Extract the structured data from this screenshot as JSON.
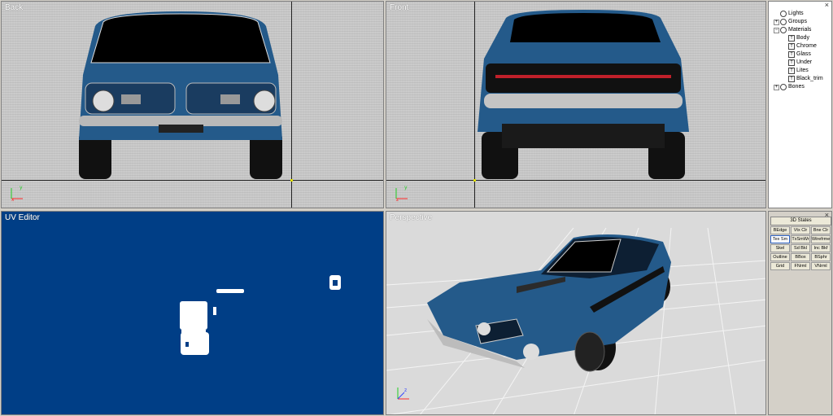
{
  "viewports": {
    "back": {
      "title": "Back"
    },
    "front": {
      "title": "Front"
    },
    "uv": {
      "title": "UV Editor"
    },
    "perspective": {
      "title": "Perspective"
    }
  },
  "scene_tree": {
    "close": "×",
    "items": [
      {
        "label": "Lights",
        "icon": "light-icon"
      },
      {
        "label": "Groups",
        "icon": "group-icon",
        "expander": "+"
      },
      {
        "label": "Materials",
        "icon": "materials-icon",
        "expander": "−"
      },
      {
        "label": "Body",
        "icon": "material-icon"
      },
      {
        "label": "Chrome",
        "icon": "material-icon"
      },
      {
        "label": "Glass",
        "icon": "material-icon"
      },
      {
        "label": "Under",
        "icon": "material-icon"
      },
      {
        "label": "Lites",
        "icon": "material-icon"
      },
      {
        "label": "Black_trim",
        "icon": "material-icon"
      },
      {
        "label": "Bones",
        "icon": "bones-icon",
        "expander": "+"
      }
    ]
  },
  "states_panel": {
    "close": "×",
    "title": "3D States",
    "buttons": [
      {
        "label": "BEdge"
      },
      {
        "label": "Vtx Clr"
      },
      {
        "label": "Bne Clr"
      },
      {
        "label": "Tex Sm",
        "active": true
      },
      {
        "label": "TxSmWr"
      },
      {
        "label": "Wirefrme"
      },
      {
        "label": "Skel"
      },
      {
        "label": "Sd Bkl"
      },
      {
        "label": "Inc Bkf"
      },
      {
        "label": "Outline"
      },
      {
        "label": "BBox"
      },
      {
        "label": "BSphr"
      },
      {
        "label": "Grid"
      },
      {
        "label": "FNrml"
      },
      {
        "label": "VNrml"
      }
    ]
  },
  "colors": {
    "car_body": "#245a8a",
    "uv_background": "#003e86",
    "axis_x": "#ff2a2a",
    "axis_y": "#22cc22",
    "axis_z": "#3344ff"
  }
}
